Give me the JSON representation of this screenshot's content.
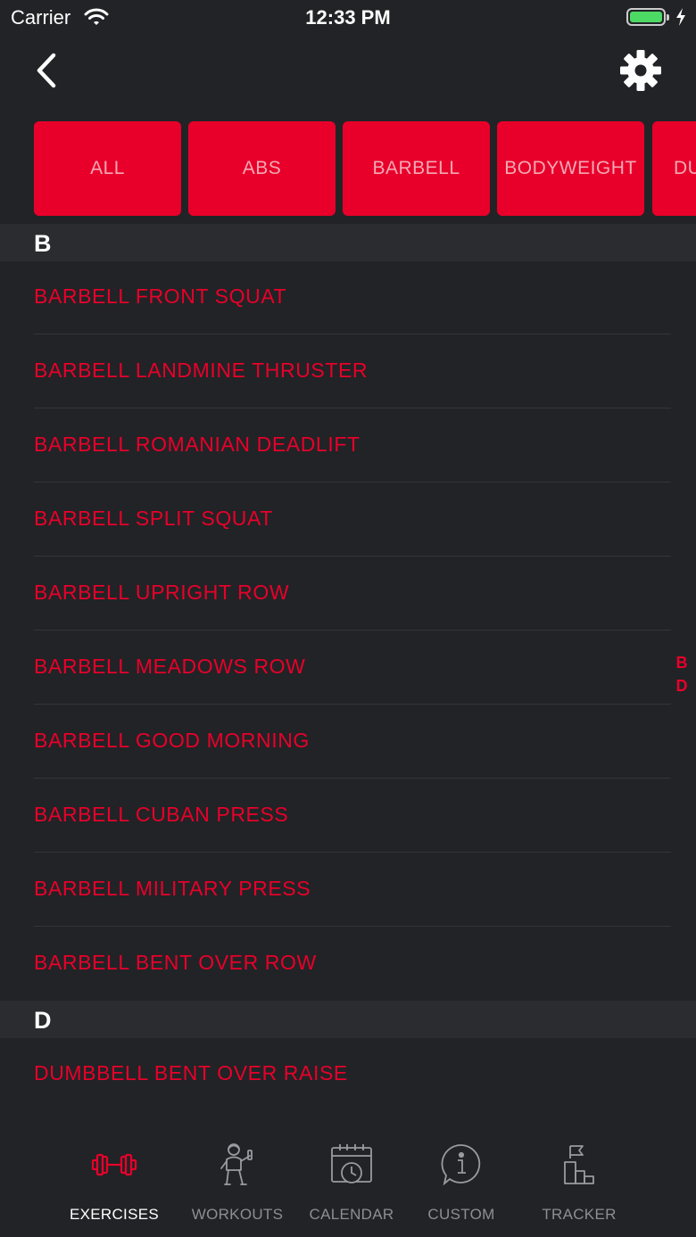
{
  "status_bar": {
    "carrier": "Carrier",
    "time": "12:33 PM"
  },
  "header": {
    "back_icon": "chevron-left-icon",
    "settings_icon": "gear-icon"
  },
  "filters": [
    {
      "label": "ALL",
      "active": true
    },
    {
      "label": "ABS",
      "active": false
    },
    {
      "label": "BARBELL",
      "active": false
    },
    {
      "label": "BODYWEIGHT",
      "active": false
    },
    {
      "label": "DU",
      "active": false
    }
  ],
  "sections": [
    {
      "letter": "B",
      "items": [
        "BARBELL FRONT SQUAT",
        "BARBELL LANDMINE THRUSTER",
        "BARBELL ROMANIAN DEADLIFT",
        "BARBELL SPLIT SQUAT",
        "BARBELL UPRIGHT ROW",
        "BARBELL MEADOWS ROW",
        "BARBELL GOOD MORNING",
        "BARBELL CUBAN PRESS",
        "BARBELL MILITARY PRESS",
        "BARBELL BENT OVER ROW"
      ]
    },
    {
      "letter": "D",
      "items": [
        "DUMBBELL BENT OVER RAISE"
      ]
    }
  ],
  "section_index": [
    "B",
    "D"
  ],
  "tabs": [
    {
      "label": "EXERCISES",
      "icon": "dumbbell-icon",
      "active": true
    },
    {
      "label": "WORKOUTS",
      "icon": "athlete-icon",
      "active": false
    },
    {
      "label": "CALENDAR",
      "icon": "calendar-icon",
      "active": false
    },
    {
      "label": "CUSTOM",
      "icon": "info-bubble-icon",
      "active": false
    },
    {
      "label": "TRACKER",
      "icon": "podium-flag-icon",
      "active": false
    }
  ],
  "colors": {
    "accent": "#e8002a",
    "background": "#222326",
    "section_header": "#2b2c30",
    "battery": "#4cd964"
  }
}
